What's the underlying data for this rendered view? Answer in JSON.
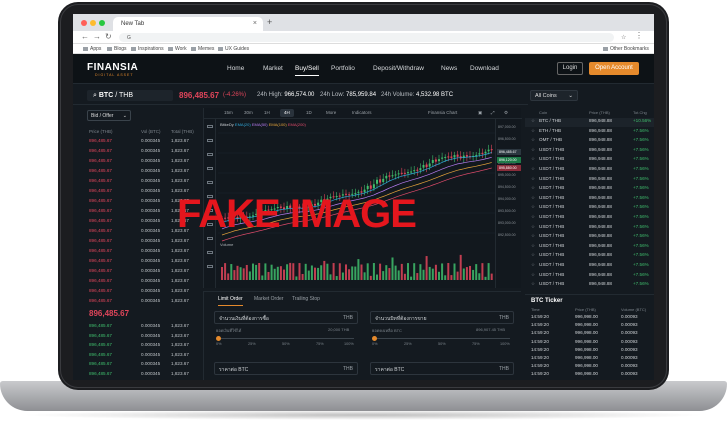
{
  "browser": {
    "tab_title": "New Tab",
    "tab_close": "×",
    "new_tab": "+",
    "url": "G",
    "bookmarks": [
      "Apps",
      "Blogs",
      "Inspirations",
      "Work",
      "Memes",
      "UX Guides"
    ],
    "other_bookmarks": "Other Bookmarks"
  },
  "site": {
    "logo": "FINANSIA",
    "logo_sub": "DIGITAL ASSET",
    "nav": [
      "Home",
      "Market",
      "Buy/Sell",
      "Portfolio",
      "Deposit/Withdraw",
      "News",
      "Download"
    ],
    "login": "Login",
    "open_account": "Open Account"
  },
  "ticker": {
    "pair_base": "BTC",
    "pair_quote": "/ THB",
    "price": "896,485.67",
    "change": "(-4.26%)",
    "high_label": "24h High:",
    "high": "966,574.00",
    "low_label": "24h Low:",
    "low": "785,959.84",
    "volume_label": "24h Volume:",
    "volume": "4,532.98 BTC",
    "coins_filter": "All Coins"
  },
  "orderbook": {
    "select": "Bid / Offer",
    "headers": [
      "Price (THB)",
      "Vol (BTC)",
      "Total (THB)"
    ],
    "asks": [
      [
        "896,485.67",
        "0.000345",
        "1,823.67"
      ],
      [
        "896,485.67",
        "0.000345",
        "1,823.67"
      ],
      [
        "896,485.67",
        "0.000345",
        "1,823.67"
      ],
      [
        "896,485.67",
        "0.000345",
        "1,823.67"
      ],
      [
        "896,485.67",
        "0.000345",
        "1,823.67"
      ],
      [
        "896,485.67",
        "0.000345",
        "1,823.67"
      ],
      [
        "896,485.67",
        "0.000345",
        "1,823.67"
      ],
      [
        "896,485.67",
        "0.000345",
        "1,823.67"
      ],
      [
        "896,485.67",
        "0.000345",
        "1,823.67"
      ],
      [
        "896,485.67",
        "0.000345",
        "1,823.67"
      ],
      [
        "896,485.67",
        "0.000345",
        "1,823.67"
      ],
      [
        "896,485.67",
        "0.000345",
        "1,823.67"
      ],
      [
        "896,485.67",
        "0.000345",
        "1,823.67"
      ],
      [
        "896,485.67",
        "0.000345",
        "1,823.67"
      ],
      [
        "896,485.67",
        "0.000345",
        "1,823.67"
      ],
      [
        "896,485.67",
        "0.000345",
        "1,823.67"
      ],
      [
        "896,485.67",
        "0.000345",
        "1,823.67"
      ]
    ],
    "last_price": "896,485.67",
    "bids": [
      [
        "896,485.67",
        "0.000345",
        "1,823.67"
      ],
      [
        "896,485.67",
        "0.000345",
        "1,823.67"
      ],
      [
        "896,485.67",
        "0.000345",
        "1,823.67"
      ],
      [
        "896,485.67",
        "0.000345",
        "1,823.67"
      ],
      [
        "896,485.67",
        "0.000345",
        "1,823.67"
      ],
      [
        "896,485.67",
        "0.000345",
        "1,823.67"
      ],
      [
        "896,485.67",
        "0.000345",
        "1,823.67"
      ]
    ]
  },
  "chart": {
    "timeframes": [
      "15m",
      "30m",
      "1H",
      "4H",
      "1D",
      "More",
      "Indicators"
    ],
    "active_timeframe": "4H",
    "source": "Finansia Chart",
    "legend": [
      "BitkeDy",
      "EMA(20)",
      "EMA(50)",
      "EMA(100)",
      "EMA(200)"
    ],
    "volume_label": "Volume",
    "overlay_text": "FAKE IMAGE",
    "axis_ticks": [
      "897,000.00",
      "896,500.00",
      "896,000.00",
      "895,500.00",
      "895,000.00",
      "894,500.00",
      "894,000.00",
      "893,500.00",
      "893,000.00",
      "892,500.00"
    ],
    "axis_tags": [
      "896,485.67",
      "896,120.00",
      "895,880.00"
    ],
    "time_ticks": [
      "10:00",
      "11:00",
      "12:00",
      "13:00"
    ]
  },
  "orderform": {
    "tabs": [
      "Limit Order",
      "Market Order",
      "Trailing Stop"
    ],
    "buy_amount_label": "จำนวนเงินที่ต้องการซื้อ",
    "sell_amount_label": "จำนวนบิทที่ต้องการขาย",
    "currency": "THB",
    "buy_note_left": "ยอดเงินที่ใช้ได้",
    "buy_note_right": "20,000 THB",
    "sell_note_left": "ยอดคงเหลือ BTC",
    "sell_note_right": "896,907.45 THB",
    "percents": [
      "0%",
      "25%",
      "50%",
      "75%",
      "100%"
    ],
    "buy_price_label": "ราคาต่อ BTC",
    "sell_price_label": "ราคาต่อ BTC"
  },
  "market": {
    "headers": [
      "Coin",
      "Price (THB)",
      "Tot.Chg"
    ],
    "rows": [
      [
        "BTC / THB",
        "896,948.88",
        "+10.56%"
      ],
      [
        "ETH / THB",
        "896,948.88",
        "+7.56%"
      ],
      [
        "OMT / THB",
        "896,948.88",
        "+7.56%"
      ],
      [
        "USDT / THB",
        "896,948.88",
        "+7.56%"
      ],
      [
        "USDT / THB",
        "896,948.88",
        "+7.56%"
      ],
      [
        "USDT / THB",
        "896,948.88",
        "+7.56%"
      ],
      [
        "USDT / THB",
        "896,948.88",
        "+7.56%"
      ],
      [
        "USDT / THB",
        "896,948.88",
        "+7.56%"
      ],
      [
        "USDT / THB",
        "896,948.88",
        "+7.56%"
      ],
      [
        "USDT / THB",
        "896,948.88",
        "+7.56%"
      ],
      [
        "USDT / THB",
        "896,948.88",
        "+7.56%"
      ],
      [
        "USDT / THB",
        "896,948.88",
        "+7.56%"
      ],
      [
        "USDT / THB",
        "896,948.88",
        "+7.56%"
      ],
      [
        "USDT / THB",
        "896,948.88",
        "+7.56%"
      ],
      [
        "USDT / THB",
        "896,948.88",
        "+7.56%"
      ],
      [
        "USDT / THB",
        "896,948.88",
        "+7.56%"
      ],
      [
        "USDT / THB",
        "896,948.88",
        "+7.56%"
      ],
      [
        "USDT / THB",
        "896,948.88",
        "+7.56%"
      ]
    ]
  },
  "btc_ticker": {
    "title": "BTC Ticker",
    "headers": [
      "Time",
      "Price (THB)",
      "Volume (BTC)"
    ],
    "rows": [
      [
        "14:59:20",
        "996,998.00",
        "0.00093"
      ],
      [
        "14:59:20",
        "996,998.00",
        "0.00093"
      ],
      [
        "14:59:20",
        "996,998.00",
        "0.00093"
      ],
      [
        "14:59:20",
        "996,998.00",
        "0.00093"
      ],
      [
        "14:59:20",
        "996,998.00",
        "0.00093"
      ],
      [
        "14:59:20",
        "996,998.00",
        "0.00093"
      ],
      [
        "14:59:20",
        "996,998.00",
        "0.00093"
      ],
      [
        "14:59:20",
        "996,998.00",
        "0.00093"
      ]
    ]
  },
  "colors": {
    "accent": "#e58a2c",
    "down": "#e0455a",
    "up": "#3fbd6c",
    "overlay": "#e4161d"
  }
}
